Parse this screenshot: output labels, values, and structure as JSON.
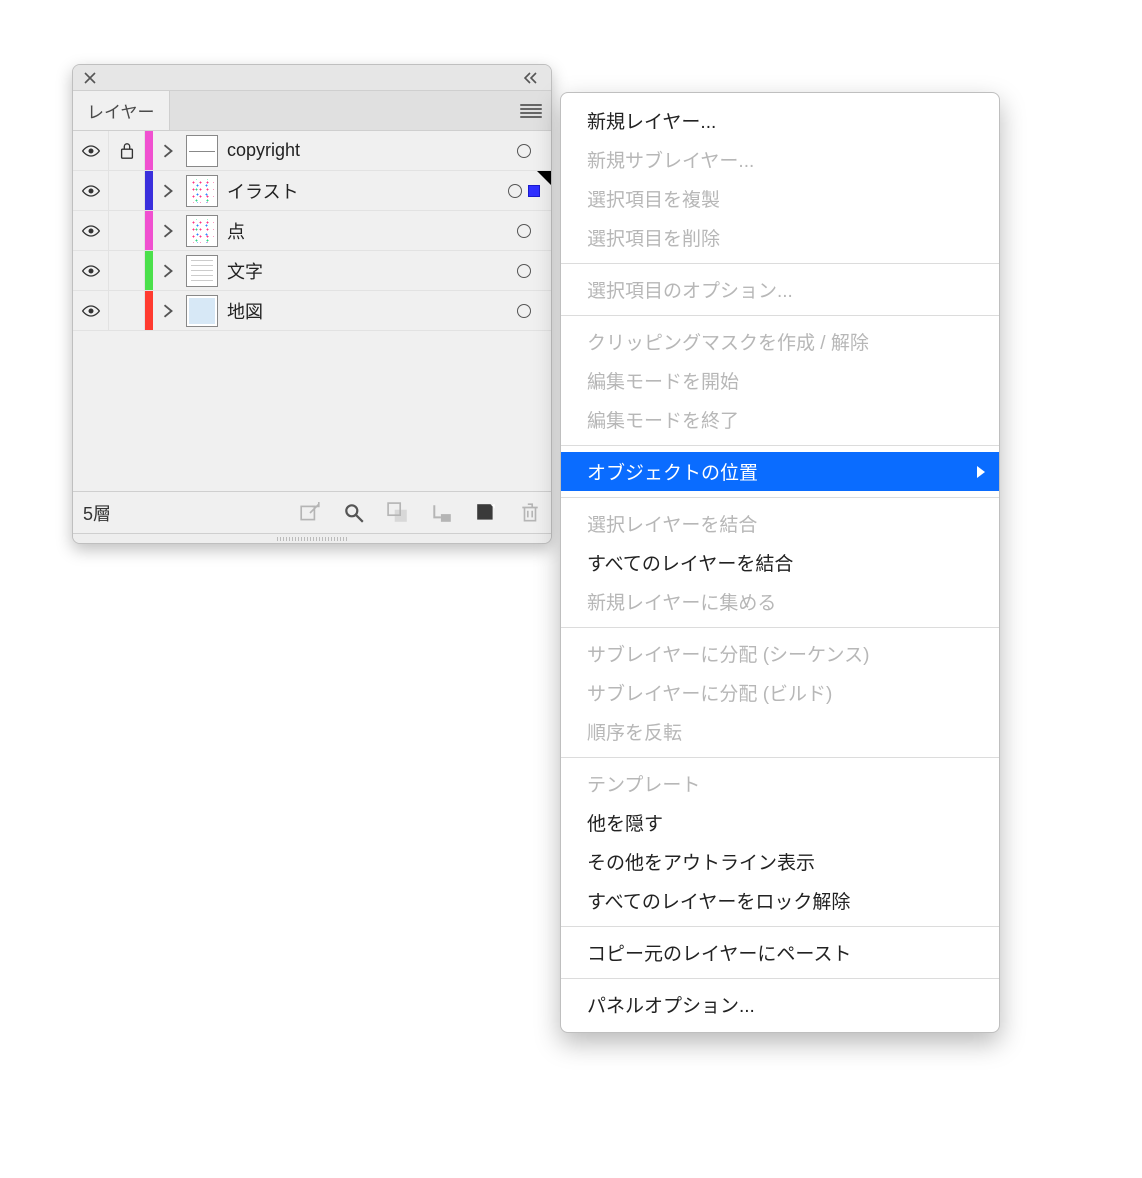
{
  "panel": {
    "tab_label": "レイヤー",
    "footer_count": "5層"
  },
  "layers": [
    {
      "name": "copyright",
      "color": "#f050d0",
      "locked": true,
      "selected": false,
      "thumb": "line"
    },
    {
      "name": "イラスト",
      "color": "#3a2fdc",
      "locked": false,
      "selected": true,
      "thumb": "dots"
    },
    {
      "name": "点",
      "color": "#f050d0",
      "locked": false,
      "selected": false,
      "thumb": "dots"
    },
    {
      "name": "文字",
      "color": "#4be04b",
      "locked": false,
      "selected": false,
      "thumb": "text"
    },
    {
      "name": "地図",
      "color": "#ff3b30",
      "locked": false,
      "selected": false,
      "thumb": "map"
    }
  ],
  "menu": {
    "groups": [
      [
        {
          "label": "新規レイヤー...",
          "enabled": true
        },
        {
          "label": "新規サブレイヤー...",
          "enabled": false
        },
        {
          "label": "選択項目を複製",
          "enabled": false
        },
        {
          "label": "選択項目を削除",
          "enabled": false
        }
      ],
      [
        {
          "label": "選択項目のオプション...",
          "enabled": false
        }
      ],
      [
        {
          "label": "クリッピングマスクを作成 / 解除",
          "enabled": false
        },
        {
          "label": "編集モードを開始",
          "enabled": false
        },
        {
          "label": "編集モードを終了",
          "enabled": false
        }
      ],
      [
        {
          "label": "オブジェクトの位置",
          "enabled": true,
          "highlight": true,
          "submenu": true
        }
      ],
      [
        {
          "label": "選択レイヤーを結合",
          "enabled": false
        },
        {
          "label": "すべてのレイヤーを結合",
          "enabled": true
        },
        {
          "label": "新規レイヤーに集める",
          "enabled": false
        }
      ],
      [
        {
          "label": "サブレイヤーに分配 (シーケンス)",
          "enabled": false
        },
        {
          "label": "サブレイヤーに分配 (ビルド)",
          "enabled": false
        },
        {
          "label": "順序を反転",
          "enabled": false
        }
      ],
      [
        {
          "label": "テンプレート",
          "enabled": false
        },
        {
          "label": "他を隠す",
          "enabled": true
        },
        {
          "label": "その他をアウトライン表示",
          "enabled": true
        },
        {
          "label": "すべてのレイヤーをロック解除",
          "enabled": true
        }
      ],
      [
        {
          "label": "コピー元のレイヤーにペースト",
          "enabled": true
        }
      ],
      [
        {
          "label": "パネルオプション...",
          "enabled": true
        }
      ]
    ]
  }
}
